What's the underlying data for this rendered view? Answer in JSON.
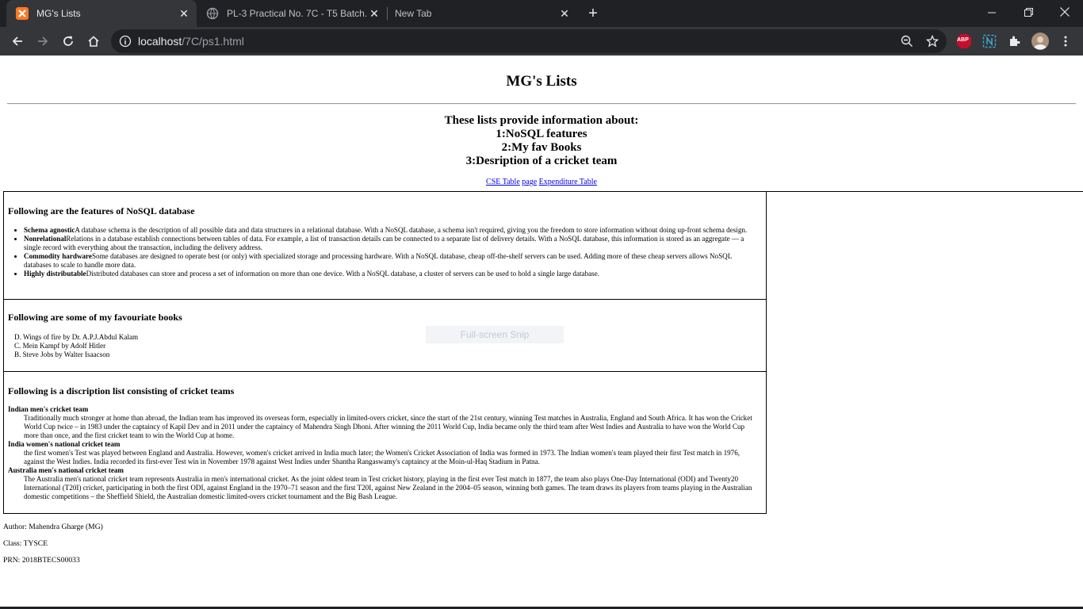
{
  "browser": {
    "tabs": [
      {
        "title": "MG's Lists",
        "active": true
      },
      {
        "title": "PL-3 Practical No. 7C - T5 Batch.pdf",
        "active": false
      },
      {
        "title": "New Tab",
        "active": false
      }
    ],
    "url_host": "localhost",
    "url_path": "/7C/ps1.html",
    "icons": {
      "back": "arrow-left-icon",
      "forward": "arrow-right-icon",
      "reload": "reload-icon",
      "home": "home-icon",
      "zoom": "zoom-out-icon",
      "bookmark": "star-icon",
      "adblock": "abp-icon",
      "extension_n": "n-extension-icon",
      "extensions": "puzzle-icon",
      "profile": "avatar",
      "menu": "kebab-menu-icon"
    },
    "adblock_label": "ABP",
    "colors": {
      "chrome_dark": "#202124",
      "chrome_toolbar": "#35363a",
      "abp_red": "#c70d2c",
      "favicon_orange": "#fb7a24"
    }
  },
  "page": {
    "title": "MG's Lists",
    "intro": [
      "These lists provide information about:",
      "1:NoSQL features",
      "2:My fav Books",
      "3:Desription of a cricket team"
    ],
    "links": {
      "cse_table": "CSE Table",
      "page": "page",
      "expenditure": "Expenditure Table"
    },
    "nosql": {
      "heading": "Following are the features of NoSQL database",
      "items": [
        {
          "term": "Schema agnostic",
          "text": "A database schema is the description of all possible data and data structures in a relational database. With a NoSQL database, a schema isn't required, giving you the freedom to store information without doing up-front schema design."
        },
        {
          "term": "Nonrelational",
          "text": "Relations in a database establish connections between tables of data. For example, a list of transaction details can be connected to a separate list of delivery details. With a NoSQL database, this information is stored as an aggregate — a single record with everything about the transaction, including the delivery address."
        },
        {
          "term": "Commodity hardware",
          "text": "Some databases are designed to operate best (or only) with specialized storage and processing hardware. With a NoSQL database, cheap off-the-shelf servers can be used. Adding more of these cheap servers allows NoSQL databases to scale to handle more data."
        },
        {
          "term": "Highly distributable",
          "text": "Distributed databases can store and process a set of information on more than one device. With a NoSQL database, a cluster of servers can be used to hold a single large database."
        }
      ]
    },
    "books": {
      "heading": "Following are some of my favouriate books",
      "items": [
        {
          "marker": "D.",
          "text": "Wings of fire by Dr. A.P.J.Abdul Kalam"
        },
        {
          "marker": "C.",
          "text": "Mein Kampf by Adolf Hitler"
        },
        {
          "marker": "B.",
          "text": "Steve Jobs by Walter Isaacson"
        }
      ]
    },
    "cricket": {
      "heading": "Following is a discription list consisting of cricket teams",
      "teams": [
        {
          "name": "Indian men's cricket team",
          "desc": "Traditionally much stronger at home than abroad, the Indian team has improved its overseas form, especially in limited-overs cricket, since the start of the 21st century, winning Test matches in Australia, England and South Africa. It has won the Cricket World Cup twice – in 1983 under the captaincy of Kapil Dev and in 2011 under the captaincy of Mahendra Singh Dhoni. After winning the 2011 World Cup, India became only the third team after West Indies and Australia to have won the World Cup more than once, and the first cricket team to win the World Cup at home."
        },
        {
          "name": "India women's national cricket team",
          "desc": "the first women's Test was played between England and Australia. However, women's cricket arrived in India much later; the Women's Cricket Association of India was formed in 1973. The Indian women's team played their first Test match in 1976, against the West Indies. India recorded its first-ever Test win in November 1978 against West Indies under Shantha Rangaswamy's captaincy at the Moin-ul-Haq Stadium in Patna."
        },
        {
          "name": "Australia men's national cricket team",
          "desc": "The Australia men's national cricket team represents Australia in men's international cricket. As the joint oldest team in Test cricket history, playing in the first ever Test match in 1877, the team also plays One-Day International (ODI) and Twenty20 International (T20I) cricket, participating in both the first ODI, against England in the 1970–71 season and the first T20I, against New Zealand in the 2004–05 season, winning both games. The team draws its players from teams playing in the Australian domestic competitions – the Sheffield Shield, the Australian domestic limited-overs cricket tournament and the Big Bash League."
        }
      ]
    },
    "footer": {
      "author": "Author: Mahendra Gharge (MG)",
      "class": "Class: TYSCE",
      "prn": "PRN: 2018BTECS00033"
    },
    "snip_overlay": "Full-screen Snip"
  }
}
